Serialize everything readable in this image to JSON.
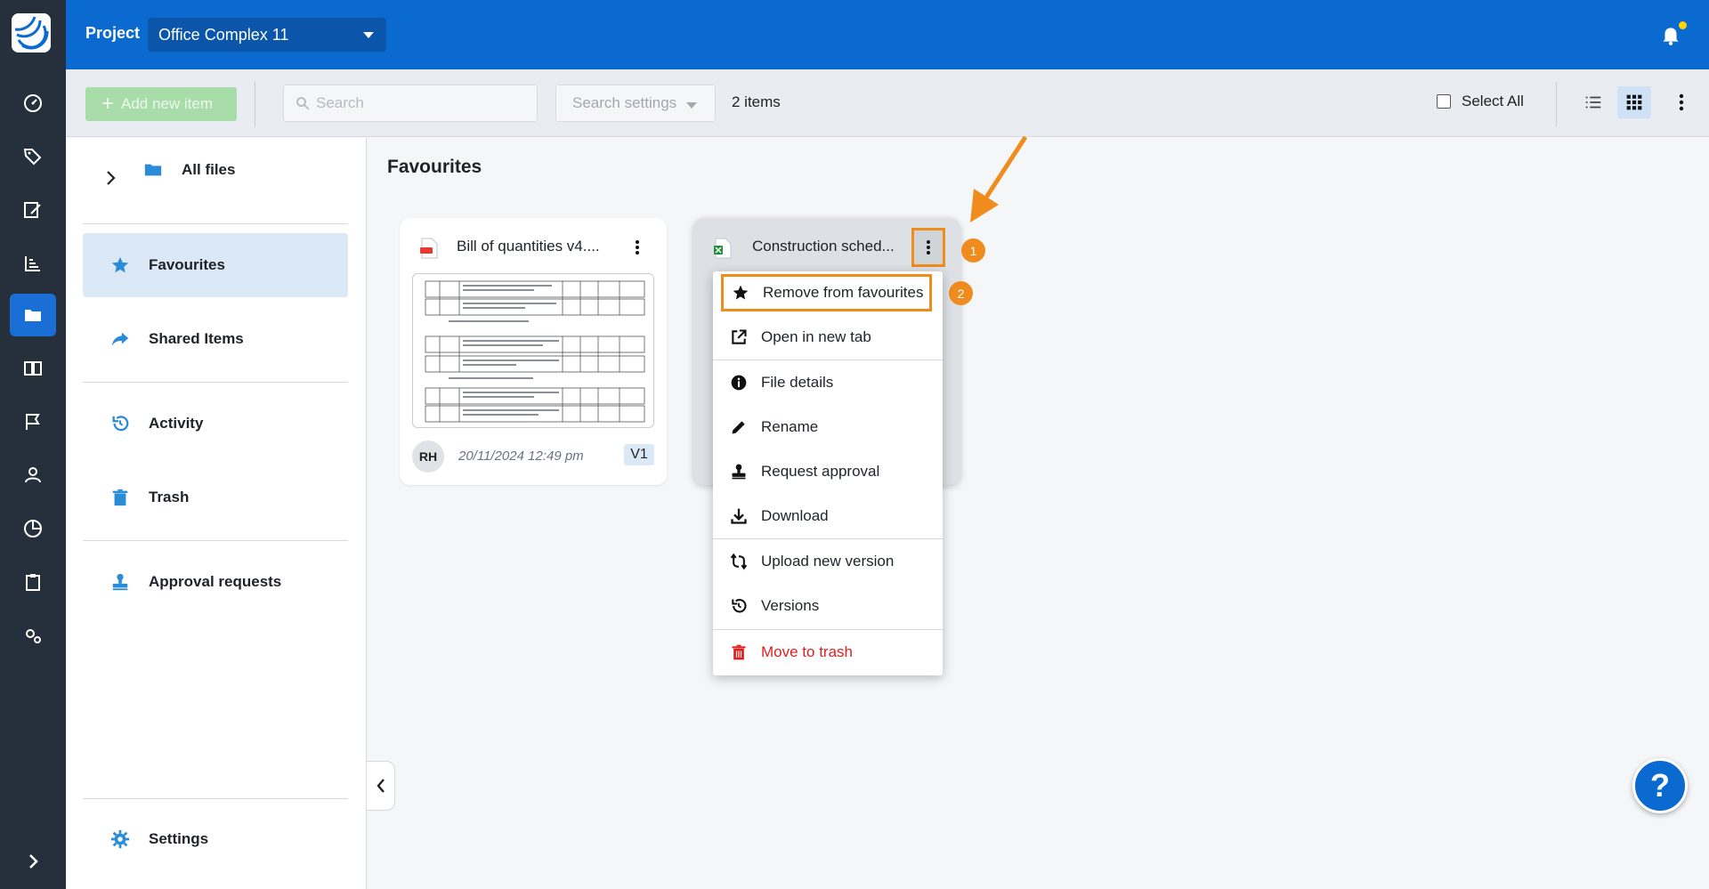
{
  "colors": {
    "brand_blue": "#0a6ad0",
    "rail": "#26303d",
    "accent_orange": "#f08c1e",
    "danger": "#e02020"
  },
  "header": {
    "project_label": "Project",
    "project_name": "Office Complex 11"
  },
  "toolbar": {
    "add_label": "Add new item",
    "search_placeholder": "Search",
    "search_settings_label": "Search settings",
    "items_count": "2 items",
    "select_all_label": "Select All"
  },
  "rail_icons": [
    "dashboard-icon",
    "tags-icon",
    "signature-icon",
    "chart-icon",
    "folder-icon",
    "book-icon",
    "flag-icon",
    "user-icon",
    "pie-chart-icon",
    "clipboard-icon",
    "gears-icon",
    "chevron-right-icon"
  ],
  "sidebar": {
    "items": [
      {
        "label": "All files",
        "icon": "folder-icon"
      },
      {
        "label": "Favourites",
        "icon": "star-icon"
      },
      {
        "label": "Shared Items",
        "icon": "share-icon"
      },
      {
        "label": "Activity",
        "icon": "history-icon"
      },
      {
        "label": "Trash",
        "icon": "trash-icon"
      },
      {
        "label": "Approval requests",
        "icon": "stamp-icon"
      },
      {
        "label": "Settings",
        "icon": "gear-icon"
      }
    ]
  },
  "main": {
    "title": "Favourites",
    "cards": [
      {
        "name": "Bill of quantities v4....",
        "file_icon": "pdf-icon",
        "user_initials": "RH",
        "date": "20/11/2024 12:49 pm",
        "version": "V1"
      },
      {
        "name": "Construction sched...",
        "file_icon": "excel-icon"
      }
    ]
  },
  "menu": {
    "items": [
      {
        "label": "Remove from favourites",
        "icon": "star-icon"
      },
      {
        "label": "Open in new tab",
        "icon": "external-link-icon"
      },
      {
        "label": "File details",
        "icon": "info-icon"
      },
      {
        "label": "Rename",
        "icon": "pencil-icon"
      },
      {
        "label": "Request approval",
        "icon": "stamp-icon"
      },
      {
        "label": "Download",
        "icon": "download-icon"
      },
      {
        "label": "Upload new version",
        "icon": "sync-icon"
      },
      {
        "label": "Versions",
        "icon": "history-icon"
      },
      {
        "label": "Move to trash",
        "icon": "trash-icon"
      }
    ]
  },
  "annotations": {
    "step1": "1",
    "step2": "2"
  },
  "help_label": "?"
}
